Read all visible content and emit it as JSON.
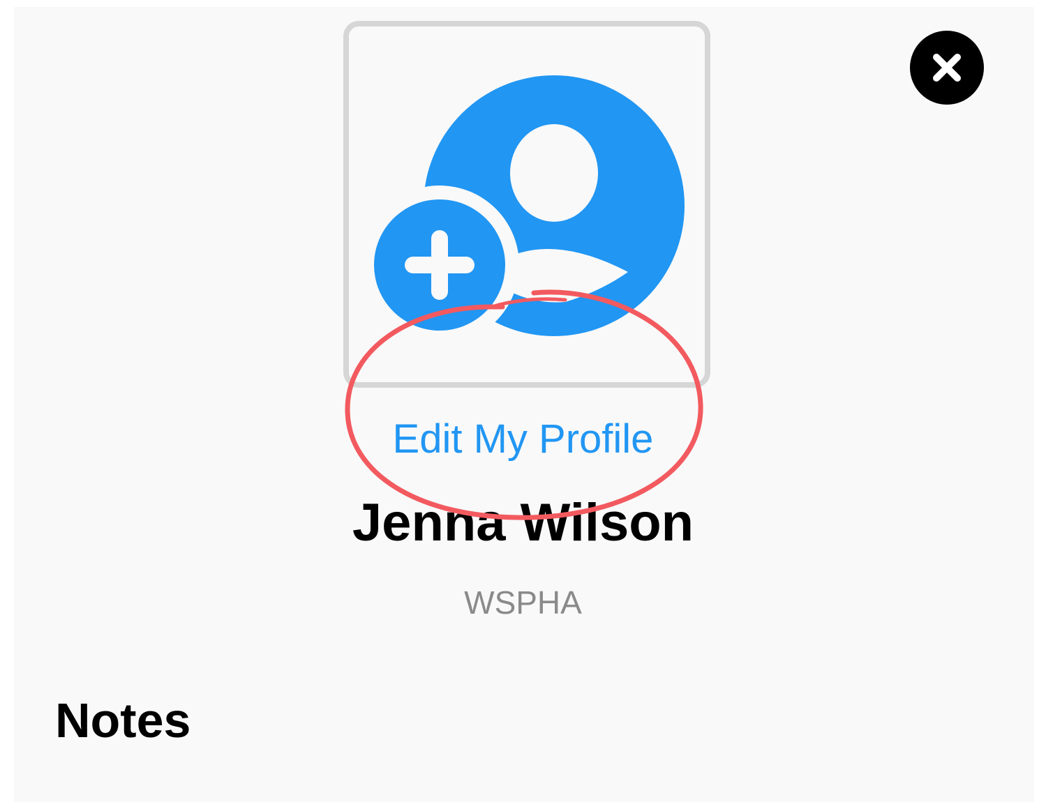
{
  "profile": {
    "edit_link_label": "Edit My Profile",
    "name": "Jenna Wilson",
    "organization": "WSPHA"
  },
  "sections": {
    "notes_heading": "Notes"
  },
  "icons": {
    "avatar": "add-user-icon",
    "close": "close-icon"
  },
  "colors": {
    "accent": "#2196f3",
    "annotation": "#f25a5f",
    "frame_border": "#d6d6d6",
    "background": "#f9f9f9",
    "secondary_text": "#8a8a8a"
  }
}
